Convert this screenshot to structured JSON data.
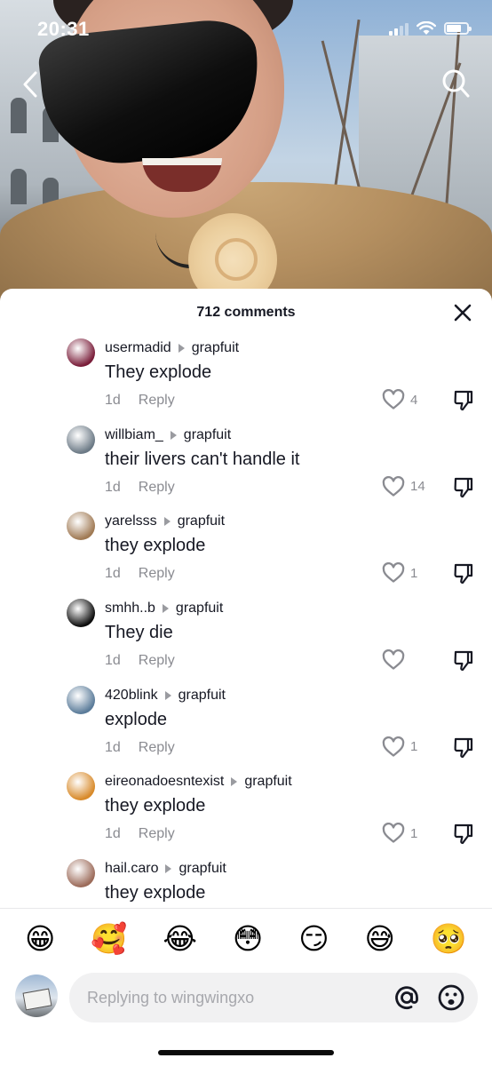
{
  "status_bar": {
    "time": "20:31"
  },
  "header": {
    "comment_count": "712 comments"
  },
  "comments": [
    {
      "username": "usermadid",
      "reply_to": "grapfuit",
      "text": "They explode",
      "time": "1d",
      "reply_label": "Reply",
      "likes": "4",
      "avatar_color": "#7a1e3a"
    },
    {
      "username": "willbiam_",
      "reply_to": "grapfuit",
      "text": "their livers can't handle it",
      "time": "1d",
      "reply_label": "Reply",
      "likes": "14",
      "avatar_color": "#6c7a86"
    },
    {
      "username": "yarelsss",
      "reply_to": "grapfuit",
      "text": "they explode",
      "time": "1d",
      "reply_label": "Reply",
      "likes": "1",
      "avatar_color": "#a07a54"
    },
    {
      "username": "smhh..b",
      "reply_to": "grapfuit",
      "text": "They die",
      "time": "1d",
      "reply_label": "Reply",
      "likes": "",
      "avatar_color": "#0d0d0d"
    },
    {
      "username": "420blink",
      "reply_to": "grapfuit",
      "text": "explode",
      "time": "1d",
      "reply_label": "Reply",
      "likes": "1",
      "avatar_color": "#5b7c9a"
    },
    {
      "username": "eireonadoesntexist",
      "reply_to": "grapfuit",
      "text": "they explode",
      "time": "1d",
      "reply_label": "Reply",
      "likes": "1",
      "avatar_color": "#d88a2a"
    },
    {
      "username": "hail.caro",
      "reply_to": "grapfuit",
      "text": "they explode",
      "time": "",
      "reply_label": "",
      "likes": "",
      "avatar_color": "#9c6b5a"
    }
  ],
  "emoji_bar": [
    "😁",
    "🥰",
    "😂",
    "😳",
    "😏",
    "😅",
    "🥺"
  ],
  "input": {
    "placeholder": "Replying to wingwingxo"
  },
  "colors": {
    "text_primary": "#161823",
    "text_secondary": "#8a8b91",
    "sheet_bg": "#ffffff"
  }
}
